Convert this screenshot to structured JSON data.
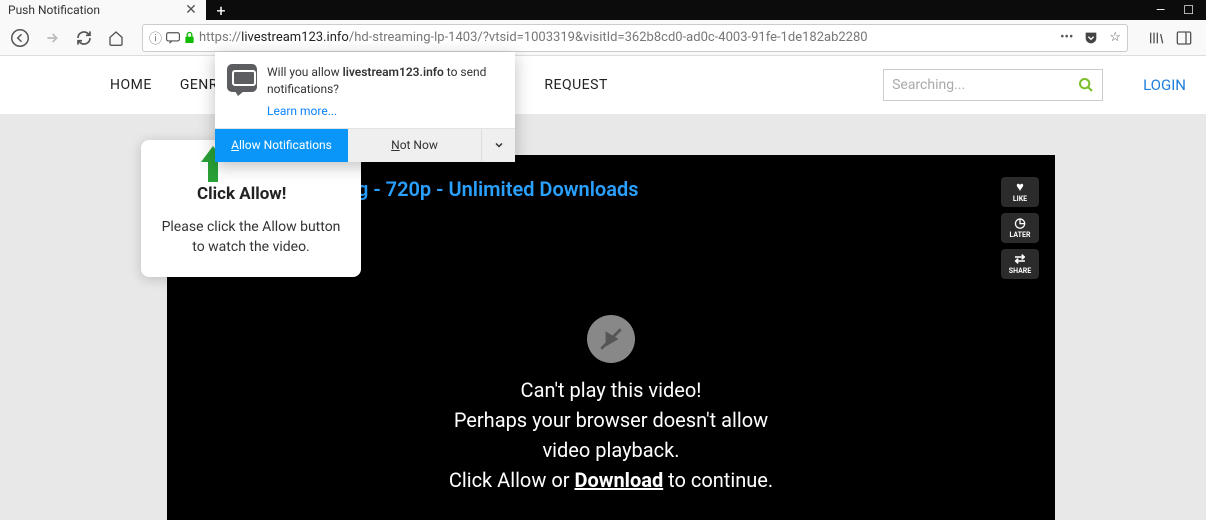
{
  "window": {
    "tab_title": "Push Notification",
    "minimize": "—",
    "maximize": "☐"
  },
  "url": {
    "prefix": "https://",
    "domain": "livestream123.info",
    "path": "/hd-streaming-lp-1403/?vtsid=1003319&visitId=362b8cd0-ad0c-4003-91fe-1de182ab2280"
  },
  "nav": {
    "home": "HOME",
    "genre": "GENRE",
    "request": "REQUEST",
    "search_placeholder": "Searching...",
    "login": "LOGIN"
  },
  "perm": {
    "text_pre": "Will you allow ",
    "domain": "livestream123.info",
    "text_post": " to send notifications?",
    "learn": "Learn more...",
    "allow_u": "A",
    "allow_rest": "llow Notifications",
    "not_u": "N",
    "not_rest": "ot Now"
  },
  "hint": {
    "title": "Click Allow!",
    "line1": "Please click the Allow button",
    "line2": "to watch the video."
  },
  "video": {
    "title_part": "g - 720p - Unlimited Downloads",
    "badges": [
      {
        "icon": "♥",
        "label": "LIKE"
      },
      {
        "icon": "◷",
        "label": "LATER"
      },
      {
        "icon": "⇄",
        "label": "SHARE"
      }
    ],
    "msg1": "Can't play this video!",
    "msg2": "Perhaps your browser doesn't allow",
    "msg3": "video playback.",
    "msg4a": "Click Allow or ",
    "msg4b": "Download",
    "msg4c": " to continue."
  }
}
